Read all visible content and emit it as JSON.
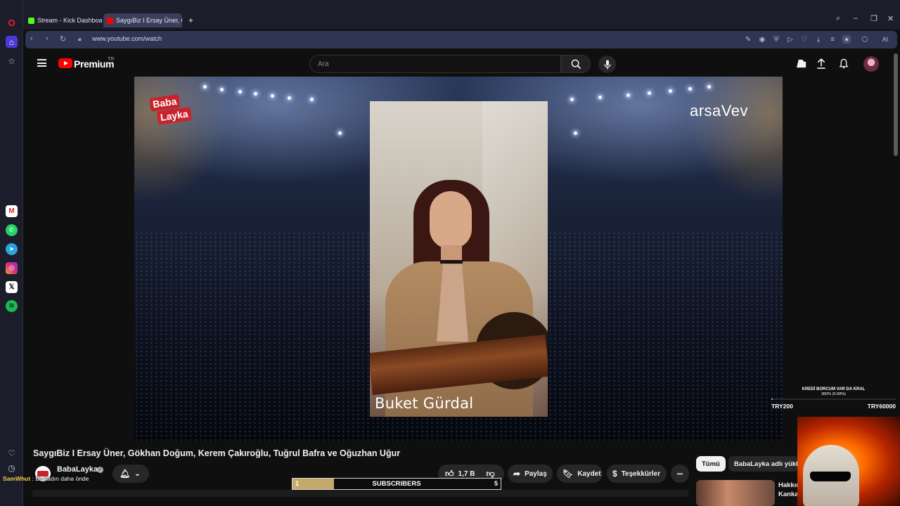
{
  "browser": {
    "tabs": [
      {
        "label": "Stream - Kick Dashboard",
        "color": "#53fc18"
      },
      {
        "label": "SaygıBiz I Ersay Üner, Gök",
        "color": "#ff0000"
      }
    ],
    "new_tab": "+",
    "url": "www.youtube.com/watch",
    "ai_label": "AI"
  },
  "youtube": {
    "logo_text": "Premium",
    "region": "TR",
    "search_placeholder": "Ara"
  },
  "video": {
    "brand_left": [
      "Baba",
      "Layka"
    ],
    "brand_right": "arsaVev",
    "performer_caption": "Buket Gürdal"
  },
  "meta": {
    "title": "SaygıBiz I Ersay Üner, Gökhan Doğum, Kerem Çakıroğlu, Tuğrul Bafra ve Oğuzhan Uğur",
    "channel": "BabaLayka",
    "verified_mark": "✓",
    "likes": "1,7 B",
    "share": "Paylaş",
    "save": "Kaydet",
    "thanks": "Teşekkürler",
    "more": "•••"
  },
  "chips": {
    "all": "Tümü",
    "channel_uploads": "BabaLayka adlı yükley"
  },
  "recommendation": {
    "title": "Hakkın Kanka"
  },
  "overlay": {
    "chat": {
      "user": "SamWhut",
      "separator": " : ",
      "message": "Bu kadın daha önde"
    },
    "subscribers": {
      "label": "SUBSCRIBERS",
      "current": "1",
      "goal": "5",
      "progress": 0.2
    },
    "donation": {
      "title": "KREDİ BORCUM VAR DA KRAL",
      "percent": "360% (0.68%)",
      "min": "TRY200",
      "max": "TRY60000",
      "progress": 0.0068
    }
  },
  "colors": {
    "youtube_red": "#ff0000",
    "opera_red": "#ff1b2d",
    "babalayka_red": "#c8232c",
    "sub_fill": "#c5a96a"
  },
  "sidebar_icons": [
    "opera-logo-icon",
    "home-icon",
    "star-icon",
    "gmail-icon",
    "whatsapp-icon",
    "telegram-icon",
    "instagram-icon",
    "x-icon",
    "spotify-icon",
    "heart-icon",
    "history-icon",
    "more-icon"
  ]
}
